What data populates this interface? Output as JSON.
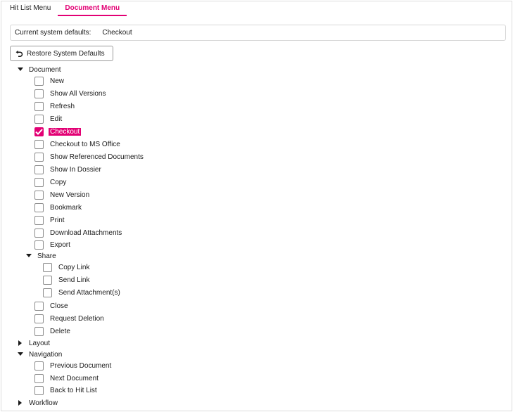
{
  "tabs": [
    {
      "label": "Hit List Menu",
      "active": false
    },
    {
      "label": "Document Menu",
      "active": true
    }
  ],
  "defaults": {
    "label": "Current system defaults:",
    "value": "Checkout"
  },
  "restore_button": {
    "label": "Restore System Defaults",
    "icon": "undo-icon"
  },
  "accent_color": "#e20074",
  "tree": {
    "document": {
      "label": "Document",
      "expanded": true,
      "items": [
        {
          "label": "New",
          "checked": false
        },
        {
          "label": "Show All Versions",
          "checked": false
        },
        {
          "label": "Refresh",
          "checked": false
        },
        {
          "label": "Edit",
          "checked": false
        },
        {
          "label": "Checkout",
          "checked": true
        },
        {
          "label": "Checkout to MS Office",
          "checked": false
        },
        {
          "label": "Show Referenced Documents",
          "checked": false
        },
        {
          "label": "Show In Dossier",
          "checked": false
        },
        {
          "label": "Copy",
          "checked": false
        },
        {
          "label": "New Version",
          "checked": false
        },
        {
          "label": "Bookmark",
          "checked": false
        },
        {
          "label": "Print",
          "checked": false
        },
        {
          "label": "Download Attachments",
          "checked": false
        },
        {
          "label": "Export",
          "checked": false
        }
      ],
      "share": {
        "label": "Share",
        "expanded": true,
        "items": [
          {
            "label": "Copy Link",
            "checked": false
          },
          {
            "label": "Send Link",
            "checked": false
          },
          {
            "label": "Send Attachment(s)",
            "checked": false
          }
        ]
      },
      "items_after": [
        {
          "label": "Close",
          "checked": false
        },
        {
          "label": "Request Deletion",
          "checked": false
        },
        {
          "label": "Delete",
          "checked": false
        }
      ]
    },
    "layout": {
      "label": "Layout",
      "expanded": false
    },
    "navigation": {
      "label": "Navigation",
      "expanded": true,
      "items": [
        {
          "label": "Previous Document",
          "checked": false
        },
        {
          "label": "Next Document",
          "checked": false
        },
        {
          "label": "Back to Hit List",
          "checked": false
        }
      ]
    },
    "workflow": {
      "label": "Workflow",
      "expanded": false
    }
  }
}
